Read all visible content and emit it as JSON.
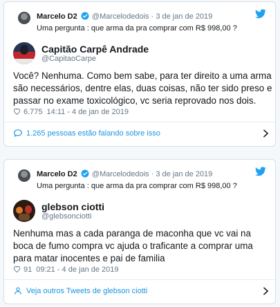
{
  "tweets": [
    {
      "quoted": {
        "name": "Marcelo D2",
        "handle": "@Marcelodedois",
        "date": "· 3 de jan de 2019",
        "text": "Uma pergunta : que arma da pra comprar com R$ 998,00 ?"
      },
      "author": {
        "name": "Capitão Carpê Andrade",
        "handle": "@CapitaoCarpe"
      },
      "text": "Você? Nenhuma. Como bem sabe, para ter direito a uma arma são necessários, dentre elas, duas coisas, não ter sido preso e passar no exame toxicológico, vc seria reprovado nos dois.",
      "likes": "6.775",
      "timestamp": "14:11 - 4 de jan de 2019",
      "footer": {
        "icon": "speech-bubble-icon",
        "text": "1.265 pessoas estão falando sobre isso"
      }
    },
    {
      "quoted": {
        "name": "Marcelo D2",
        "handle": "@Marcelodedois",
        "date": "· 3 de jan de 2019",
        "text": "Uma pergunta : que arma da pra comprar com R$ 998,00 ?"
      },
      "author": {
        "name": "glebson ciotti",
        "handle": "@glebsonciotti"
      },
      "text": "Nenhuma  mas a cada paranga de maconha que vc vai na boca de fumo compra vc ajuda o traficante a comprar  uma para matar inocentes e pai de familia",
      "likes": "91",
      "timestamp": "09:21 - 4 de jan de 2019",
      "footer": {
        "icon": "profile-icon",
        "text": "Veja outros Tweets de glebson ciotti"
      }
    }
  ],
  "colors": {
    "link": "#1b95e0",
    "verified": "#1da1f2",
    "muted": "#657786",
    "like": "#e0245e"
  }
}
